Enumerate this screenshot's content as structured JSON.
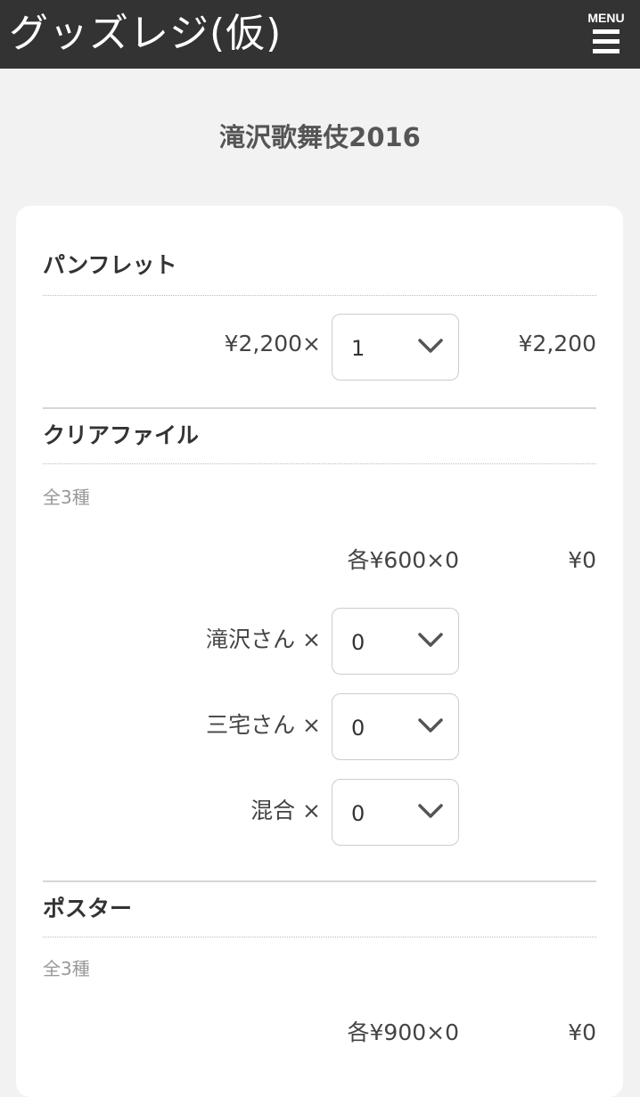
{
  "header": {
    "app_title": "グッズレジ(仮)",
    "menu_label": "MENU",
    "menu_icon": "hamburger-icon"
  },
  "page_title": "滝沢歌舞伎2016",
  "items": {
    "pamphlet": {
      "name": "パンフレット",
      "unit_price_label": "¥2,200×",
      "quantity": "1",
      "total": "¥2,200"
    },
    "clearfile": {
      "name": "クリアファイル",
      "variants_note": "全3種",
      "each_label": "各¥600×0",
      "total": "¥0",
      "variants": [
        {
          "label": "滝沢さん ×",
          "quantity": "0"
        },
        {
          "label": "三宅さん ×",
          "quantity": "0"
        },
        {
          "label": "混合 ×",
          "quantity": "0"
        }
      ]
    },
    "poster": {
      "name": "ポスター",
      "variants_note": "全3種",
      "each_label": "各¥900×0",
      "total": "¥0"
    }
  },
  "icons": {
    "select_arrow": "chevron-down-icon"
  },
  "colors": {
    "header_bg": "#333333",
    "page_bg": "#f2f2f2",
    "card_bg": "#ffffff"
  }
}
